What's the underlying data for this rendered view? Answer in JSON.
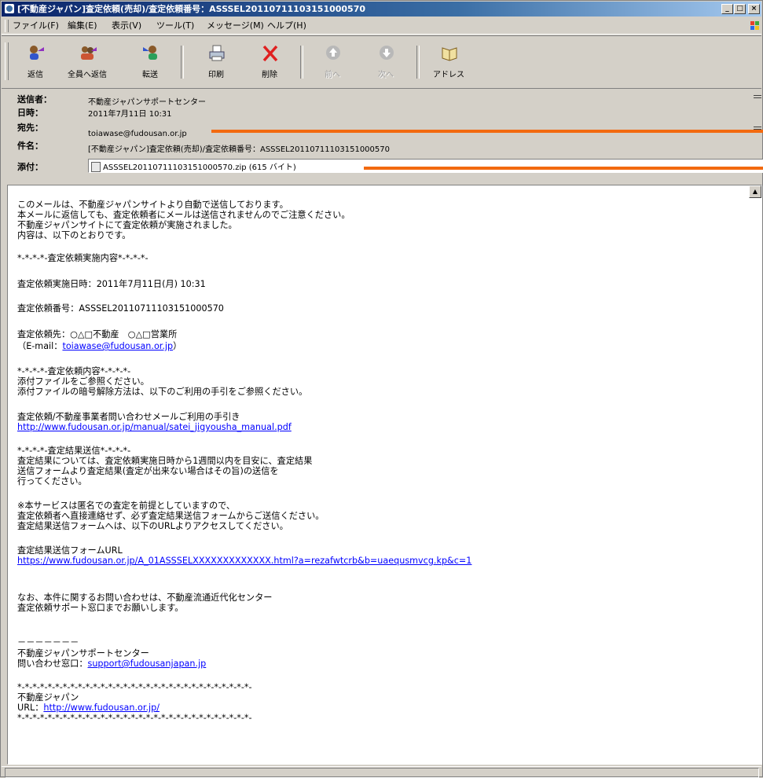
{
  "window": {
    "title": "[不動産ジャパン]査定依頼(売却)/査定依頼番号：ASSSEL20110711103151000570",
    "buttons": {
      "minimize": "_",
      "maximize": "□",
      "close": "×"
    }
  },
  "menu": {
    "items": [
      "ファイル(F)",
      "編集(E)",
      "表示(V)",
      "ツール(T)",
      "メッセージ(M)",
      "ヘルプ(H)"
    ]
  },
  "toolbar": {
    "buttons": [
      {
        "label": "返信",
        "icon": "reply-icon",
        "enabled": true
      },
      {
        "label": "全員へ返信",
        "icon": "reply-all-icon",
        "enabled": true
      },
      {
        "label": "転送",
        "icon": "forward-icon",
        "enabled": true
      },
      {
        "label": "印刷",
        "icon": "printer-icon",
        "enabled": true
      },
      {
        "label": "削除",
        "icon": "delete-icon",
        "enabled": true
      },
      {
        "label": "前へ",
        "icon": "previous-icon",
        "enabled": false
      },
      {
        "label": "次へ",
        "icon": "next-icon",
        "enabled": false
      },
      {
        "label": "アドレス",
        "icon": "address-book-icon",
        "enabled": true
      }
    ]
  },
  "header": {
    "from_label": "送信者：",
    "from_value": "不動産ジャパンサポートセンター",
    "date_label": "日時：",
    "date_value": "2011年7月11日 10:31",
    "to_label": "宛先：",
    "to_value": "toiawase@fudousan.or.jp",
    "subject_label": "件名：",
    "subject_value": "[不動産ジャパン]査定依頼(売却)/査定依頼番号：ASSSEL20110711103151000570",
    "attach_label": "添付：",
    "attach_value": "ASSSEL20110711103151000570.zip (615 バイト)"
  },
  "colors": {
    "redaction": "#f26a10",
    "link": "#0000ff",
    "title_start": "#0a246a"
  },
  "body": {
    "l1": "このメールは、不動産ジャパンサイトより自動で送信しております。",
    "l2": "本メールに返信しても、査定依頼者にメールは送信されませんのでご注意ください。",
    "l3": "不動産ジャパンサイトにて査定依頼が実施されました。",
    "l4": "内容は、以下のとおりです。",
    "l5": "*-*-*-*-査定依頼実施内容*-*-*-*-",
    "l6": "査定依頼実施日時：2011年7月11日(月) 10:31",
    "l7": "査定依頼番号：ASSSEL20110711103151000570",
    "l8": "査定依頼先：○△□不動産　○△□営業所",
    "l9_prefix": "（E-mail：",
    "l9_link": "toiawase@fudousan.or.jp",
    "l9_suffix": "）",
    "l10": "*-*-*-*-査定依頼内容*-*-*-*-",
    "l11": "添付ファイルをご参照ください。",
    "l12": "添付ファイルの暗号解除方法は、以下のご利用の手引をご参照ください。",
    "l13": "査定依頼/不動産事業者問い合わせメールご利用の手引き",
    "l14_link": "http://www.fudousan.or.jp/manual/satei_jigyousha_manual.pdf",
    "l15": "*-*-*-*-査定結果送信*-*-*-*-",
    "l16": "査定結果については、査定依頼実施日時から1週間以内を目安に、査定結果",
    "l17": "送信フォームより査定結果(査定が出来ない場合はその旨)の送信を",
    "l18": "行ってください。",
    "l19": "※本サービスは匿名での査定を前提としていますので、",
    "l20": "査定依頼者へ直接連絡せず、必ず査定結果送信フォームからご送信ください。",
    "l21": "査定結果送信フォームへは、以下のURLよりアクセスしてください。",
    "l22": "査定結果送信フォームURL",
    "l23_link": "https://www.fudousan.or.jp/A_01ASSSELXXXXXXXXXXXXX.html?a=rezafwtcrb&b=uaequsmvcg.kp&c=1",
    "l24": "なお、本件に関するお問い合わせは、不動産流通近代化センター",
    "l25": "査定依頼サポート窓口までお願いします。",
    "l26": "－－－－－－－",
    "l27": "不動産ジャパンサポートセンター",
    "l28_prefix": "問い合わせ窓口：",
    "l28_link": "support@fudousanjapan.jp",
    "l29": "*-*-*-*-*-*-*-*-*-*-*-*-*-*-*-*-*-*-*-*-*-*-*-*-*-*-*-*-*-*-*-",
    "l30": "不動産ジャパン",
    "l31_prefix": "URL：",
    "l31_link": "http://www.fudousan.or.jp/",
    "l32": "*-*-*-*-*-*-*-*-*-*-*-*-*-*-*-*-*-*-*-*-*-*-*-*-*-*-*-*-*-*-*-"
  }
}
